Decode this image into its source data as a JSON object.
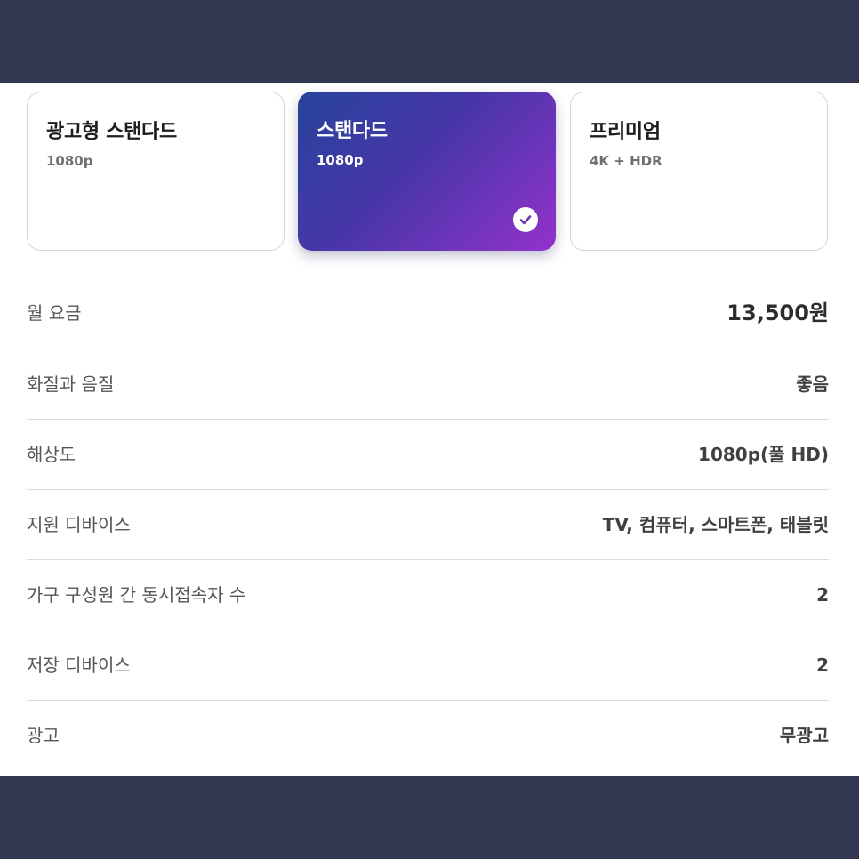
{
  "plans": [
    {
      "name": "광고형 스탠다드",
      "quality": "1080p",
      "selected": false
    },
    {
      "name": "스탠다드",
      "quality": "1080p",
      "selected": true
    },
    {
      "name": "프리미엄",
      "quality": "4K + HDR",
      "selected": false
    }
  ],
  "selected_icon": "checkmark-circle-icon",
  "colors": {
    "background": "#323651",
    "selected_gradient_start": "#26439b",
    "selected_gradient_end": "#9432cc"
  },
  "details": [
    {
      "label": "월 요금",
      "value": "13,500원"
    },
    {
      "label": "화질과 음질",
      "value": "좋음"
    },
    {
      "label": "해상도",
      "value": "1080p(풀 HD)"
    },
    {
      "label": "지원 디바이스",
      "value": "TV, 컴퓨터, 스마트폰, 태블릿"
    },
    {
      "label": "가구 구성원 간 동시접속자 수",
      "value": "2"
    },
    {
      "label": "저장 디바이스",
      "value": "2"
    },
    {
      "label": "광고",
      "value": "무광고"
    }
  ]
}
